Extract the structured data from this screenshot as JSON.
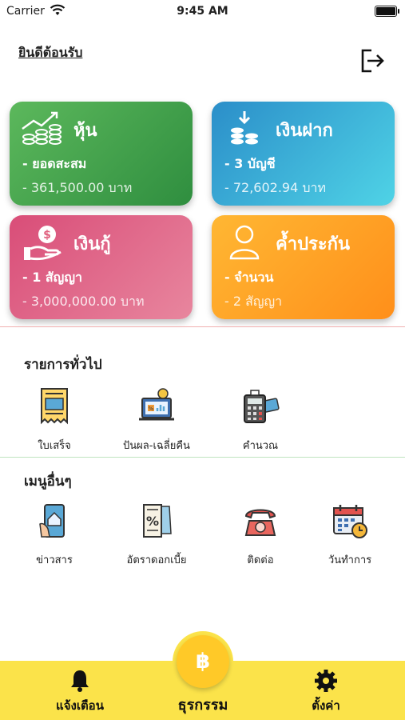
{
  "status_bar": {
    "carrier": "Carrier",
    "time": "9:45 AM"
  },
  "header": {
    "welcome": "ยินดีต้อนรับ",
    "logout_icon": "logout-icon"
  },
  "cards": {
    "stock": {
      "title": "หุ้น",
      "line1": "- ยอดสะสม",
      "line2": "- 361,500.00 บาท",
      "color": "#3fa348"
    },
    "deposit": {
      "title": "เงินฝาก",
      "line1": "- 3 บัญชี",
      "line2": "- 72,602.94 บาท",
      "color": "#3aa9d8"
    },
    "loan": {
      "title": "เงินกู้",
      "line1": "- 1 สัญญา",
      "line2": "- 3,000,000.00 บาท",
      "color": "#e0617f"
    },
    "guarantee": {
      "title": "ค้ำประกัน",
      "line1": "- จำนวน",
      "line2": "- 2 สัญญา",
      "color": "#ffa424"
    }
  },
  "general": {
    "title": "รายการทั่วไป",
    "items": [
      {
        "label": "ใบเสร็จ",
        "icon": "receipt-icon"
      },
      {
        "label": "ปันผล-เฉลี่ยคืน",
        "icon": "dividend-icon"
      },
      {
        "label": "คำนวณ",
        "icon": "calculator-icon"
      }
    ]
  },
  "other": {
    "title": "เมนูอื่นๆ",
    "items": [
      {
        "label": "ข่าวสาร",
        "icon": "news-icon"
      },
      {
        "label": "อัตราดอกเบี้ย",
        "icon": "interest-rate-icon"
      },
      {
        "label": "ติดต่อ",
        "icon": "telephone-icon"
      },
      {
        "label": "วันทำการ",
        "icon": "calendar-icon"
      }
    ]
  },
  "tabbar": {
    "notify": "แจ้งเตือน",
    "transaction": "ธุรกรรม",
    "settings": "ตั้งค่า",
    "fab_symbol": "฿"
  }
}
